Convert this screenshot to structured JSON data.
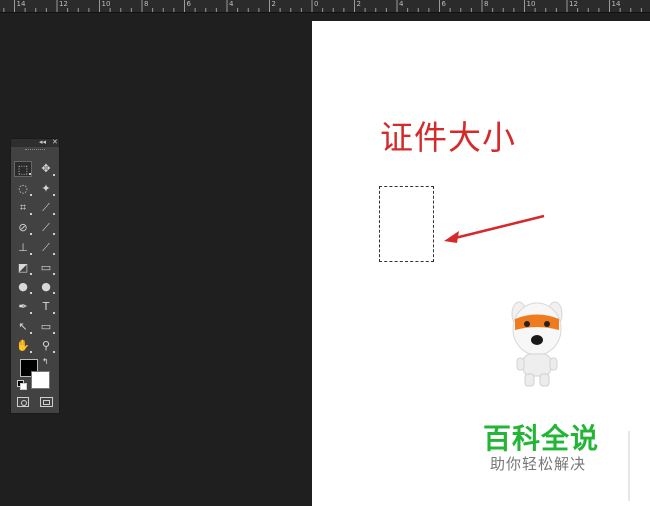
{
  "ruler": {
    "labels": [
      "14",
      "12",
      "10",
      "8",
      "6",
      "4",
      "2",
      "0",
      "2",
      "4",
      "6",
      "8",
      "10",
      "12",
      "14"
    ]
  },
  "canvas": {
    "title_text": "证件大小",
    "brand_name": "百科全说",
    "brand_tagline": "助你轻松解决",
    "colors": {
      "title": "#d42a2a",
      "arrow": "#d42a2a",
      "brand": "#23b536"
    }
  },
  "tools_panel": {
    "collapse_label": "◂◂",
    "close_label": "✕",
    "tools": [
      {
        "name": "marquee-tool-icon",
        "glyph": "⬚"
      },
      {
        "name": "move-tool-icon",
        "glyph": "✥"
      },
      {
        "name": "lasso-tool-icon",
        "glyph": "◌"
      },
      {
        "name": "magic-wand-tool-icon",
        "glyph": "✦"
      },
      {
        "name": "crop-tool-icon",
        "glyph": "⌗"
      },
      {
        "name": "eyedropper-tool-icon",
        "glyph": "⟋"
      },
      {
        "name": "healing-brush-tool-icon",
        "glyph": "⊘"
      },
      {
        "name": "brush-tool-icon",
        "glyph": "⟋"
      },
      {
        "name": "clone-stamp-tool-icon",
        "glyph": "⊥"
      },
      {
        "name": "history-brush-tool-icon",
        "glyph": "⟋"
      },
      {
        "name": "eraser-tool-icon",
        "glyph": "◩"
      },
      {
        "name": "gradient-tool-icon",
        "glyph": "▭"
      },
      {
        "name": "blur-tool-icon",
        "glyph": "●"
      },
      {
        "name": "dodge-tool-icon",
        "glyph": "●"
      },
      {
        "name": "pen-tool-icon",
        "glyph": "✒"
      },
      {
        "name": "type-tool-icon",
        "glyph": "T"
      },
      {
        "name": "path-selection-tool-icon",
        "glyph": "↖"
      },
      {
        "name": "rectangle-tool-icon",
        "glyph": "▭"
      },
      {
        "name": "hand-tool-icon",
        "glyph": "✋"
      },
      {
        "name": "zoom-tool-icon",
        "glyph": "⚲"
      }
    ],
    "swap_glyph": "↰",
    "foreground_color": "#000000",
    "background_color": "#ffffff"
  }
}
